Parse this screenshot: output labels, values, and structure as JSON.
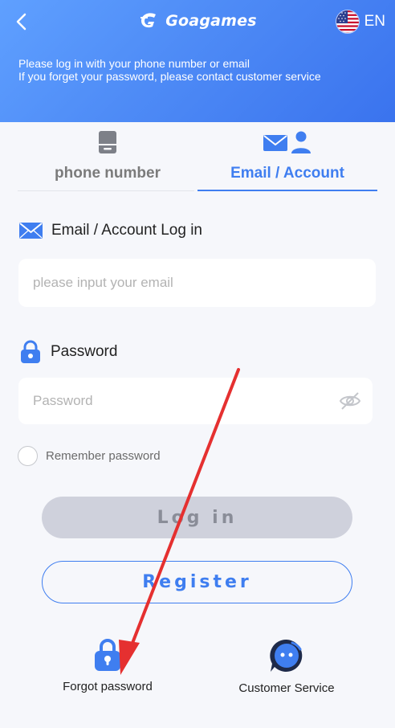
{
  "header": {
    "brand": "Goagames",
    "language": "EN",
    "notice_line1": "Please log in with your phone number or email",
    "notice_line2": "If you forget your password, please contact customer service"
  },
  "tabs": [
    {
      "label": "phone number",
      "icon": "phone-icon",
      "active": false
    },
    {
      "label": "Email / Account",
      "icon": "email-account-icon",
      "active": true
    }
  ],
  "form": {
    "email_label": "Email / Account Log in",
    "email_placeholder": "please input your email",
    "email_value": "",
    "password_label": "Password",
    "password_placeholder": "Password",
    "password_value": "",
    "remember_label": "Remember password",
    "remember_checked": false
  },
  "buttons": {
    "login": "Log in",
    "register": "Register"
  },
  "bottom_links": {
    "forgot": "Forgot password",
    "service": "Customer Service"
  },
  "colors": {
    "accent": "#3f7ef0",
    "header_gradient_start": "#5fa0ff",
    "header_gradient_end": "#3a73ee",
    "annotation_arrow": "#e53030"
  }
}
